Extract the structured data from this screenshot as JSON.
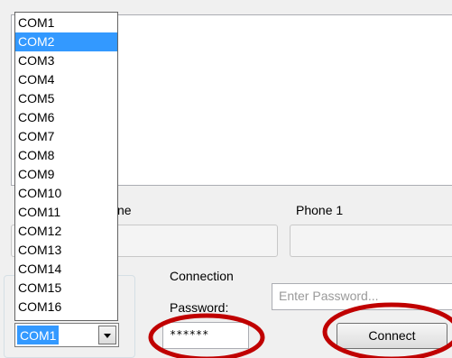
{
  "top_label": "Phone 1",
  "partial_label": "ne",
  "connection_group_label": "Connection",
  "password_label": "Password:",
  "password_value": "******",
  "password_placeholder": "Enter Password...",
  "connect_label": "Connect",
  "com_combo": {
    "selected": "COM1",
    "options": [
      "COM1",
      "COM2",
      "COM3",
      "COM4",
      "COM5",
      "COM6",
      "COM7",
      "COM8",
      "COM9",
      "COM10",
      "COM11",
      "COM12",
      "COM13",
      "COM14",
      "COM15",
      "COM16"
    ],
    "highlighted_option": "COM2"
  },
  "colors": {
    "selection": "#3399ff",
    "highlight_ring": "#c00000"
  },
  "icons": {
    "combo_arrow": "chevron-down-icon"
  }
}
